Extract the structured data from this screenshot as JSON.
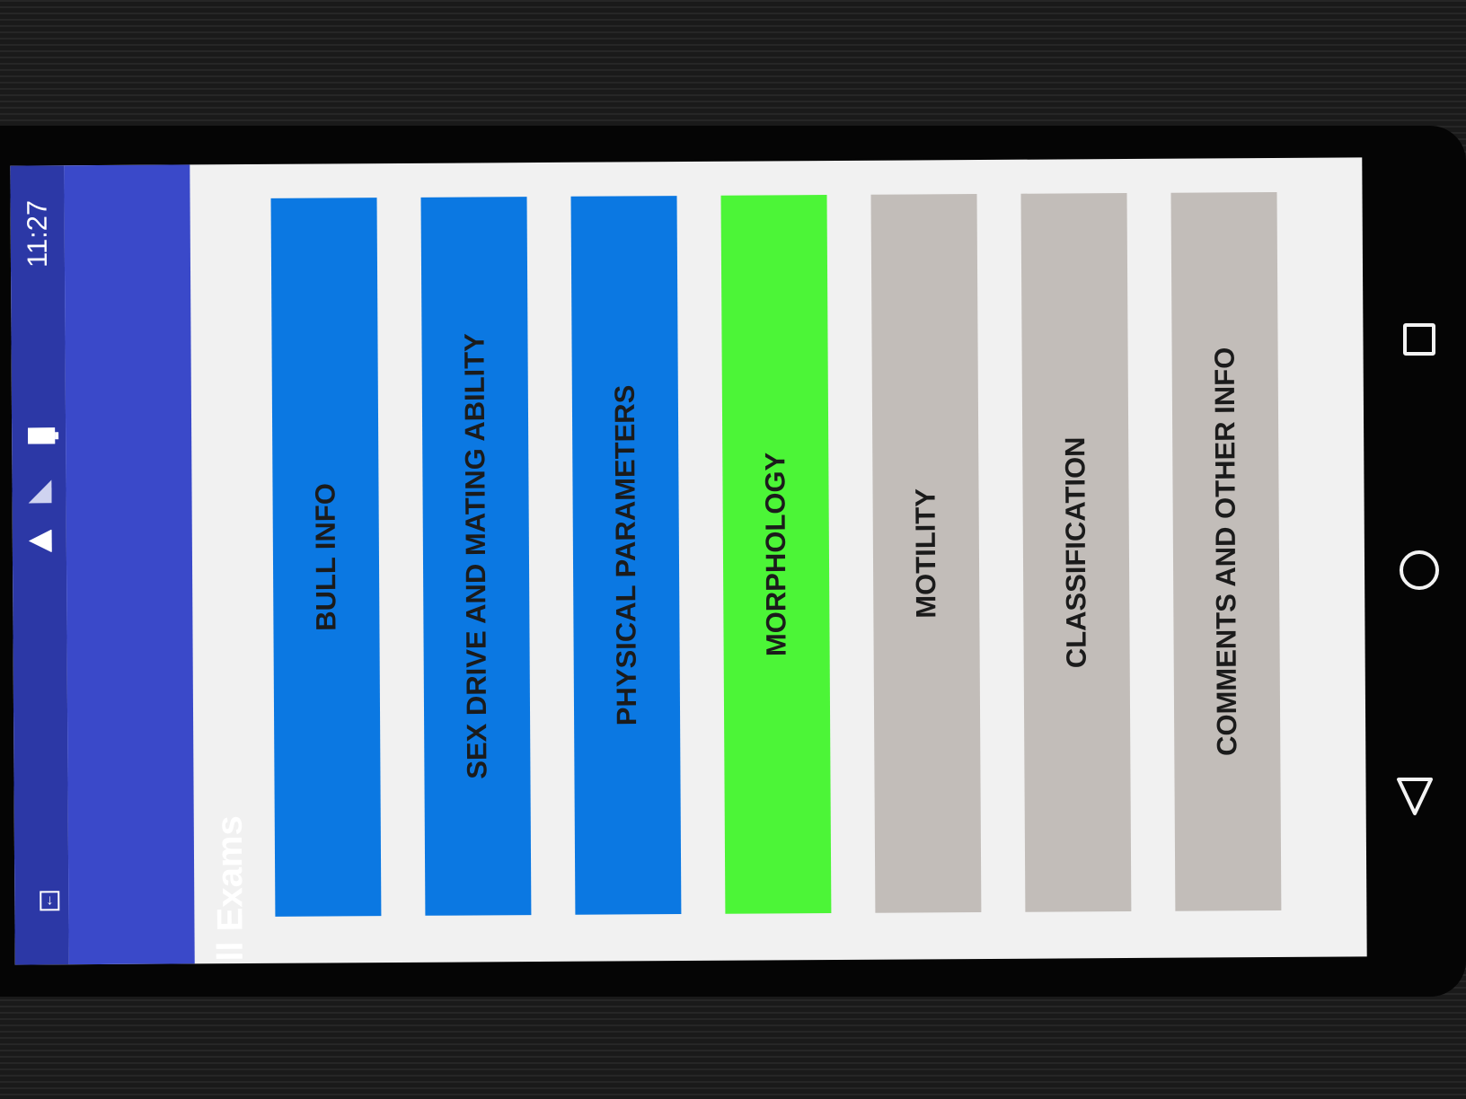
{
  "status_bar": {
    "time": "11:27",
    "icons": [
      "wifi-icon",
      "signal-icon",
      "battery-icon",
      "download-icon"
    ]
  },
  "app_bar": {
    "title": "Bull Exams"
  },
  "menu": {
    "buttons": [
      {
        "label": "BULL INFO",
        "color": "#0b78e2"
      },
      {
        "label": "SEX DRIVE AND MATING ABILITY",
        "color": "#0b78e2"
      },
      {
        "label": "PHYSICAL PARAMETERS",
        "color": "#0b78e2"
      },
      {
        "label": "MORPHOLOGY",
        "color": "#4cf537"
      },
      {
        "label": "MOTILITY",
        "color": "#c2bdb9"
      },
      {
        "label": "CLASSIFICATION",
        "color": "#c2bdb9"
      },
      {
        "label": "COMMENTS AND OTHER INFO",
        "color": "#c2bdb9"
      }
    ]
  },
  "nav_bar": {
    "icons": [
      "recent-apps-icon",
      "home-icon",
      "back-icon"
    ]
  },
  "colors": {
    "status_bar": "#2c38a6",
    "app_bar": "#3a49c9",
    "screen_background": "#f1f1f1"
  }
}
